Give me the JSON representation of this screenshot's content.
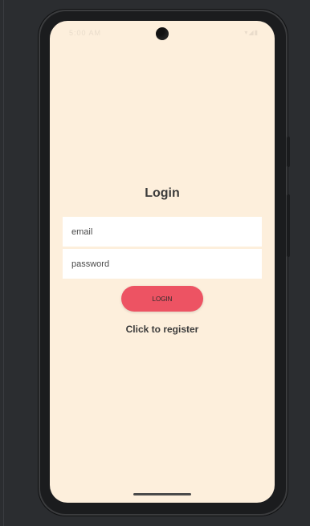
{
  "status_bar": {
    "time": "5:00 AM",
    "icons": "▾◢▮"
  },
  "login": {
    "title": "Login",
    "email_placeholder": "email",
    "password_placeholder": "password",
    "button_label": "LOGIN",
    "register_link": "Click to register"
  },
  "colors": {
    "screen_background": "#fdefdc",
    "button": "#ed5363",
    "field_background": "#ffffff",
    "emulator_background": "#2b2d30"
  }
}
